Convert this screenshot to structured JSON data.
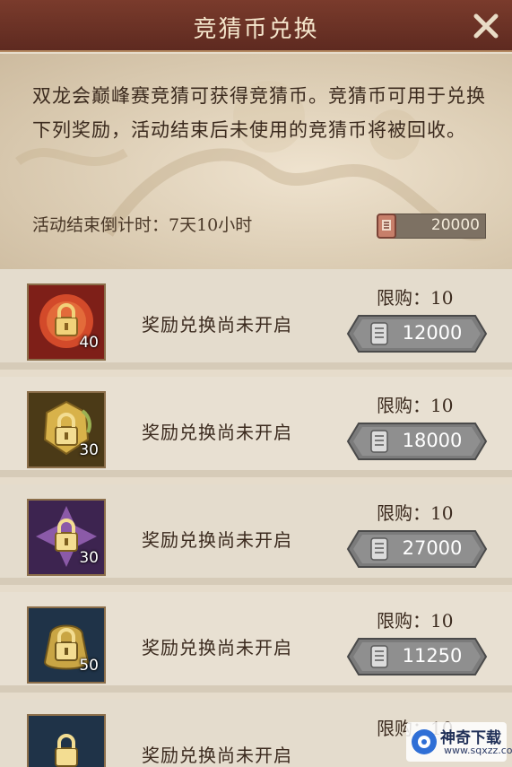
{
  "dialog": {
    "title": "竞猜币兑换",
    "close_icon": "close-icon",
    "description": "双龙会巅峰赛竞猜可获得竞猜币。竞猜币可用于兑换下列奖励，活动结束后未使用的竞猜币将被回收。",
    "countdown": "活动结束倒计时：7天10小时",
    "coin_balance": "20000",
    "coin_icon": "guess-coin-icon"
  },
  "rewards": [
    {
      "count": "40",
      "status": "奖励兑换尚未开启",
      "limit": "限购：10",
      "price": "12000",
      "frame_color": "#b23a2a",
      "icon": "locked-item-icon"
    },
    {
      "count": "30",
      "status": "奖励兑换尚未开启",
      "limit": "限购：10",
      "price": "18000",
      "frame_color": "#b8892f",
      "icon": "locked-item-icon"
    },
    {
      "count": "30",
      "status": "奖励兑换尚未开启",
      "limit": "限购：10",
      "price": "27000",
      "frame_color": "#6c3f86",
      "icon": "locked-item-icon"
    },
    {
      "count": "50",
      "status": "奖励兑换尚未开启",
      "limit": "限购：10",
      "price": "11250",
      "frame_color": "#2f4f6e",
      "icon": "locked-item-icon"
    },
    {
      "count": "",
      "status": "奖励兑换尚未开启",
      "limit": "限购：10",
      "price": "",
      "frame_color": "#2f4f6e",
      "icon": "locked-item-icon"
    }
  ],
  "watermark": {
    "name": "神奇下载",
    "url": "www.sqxzz.com"
  }
}
